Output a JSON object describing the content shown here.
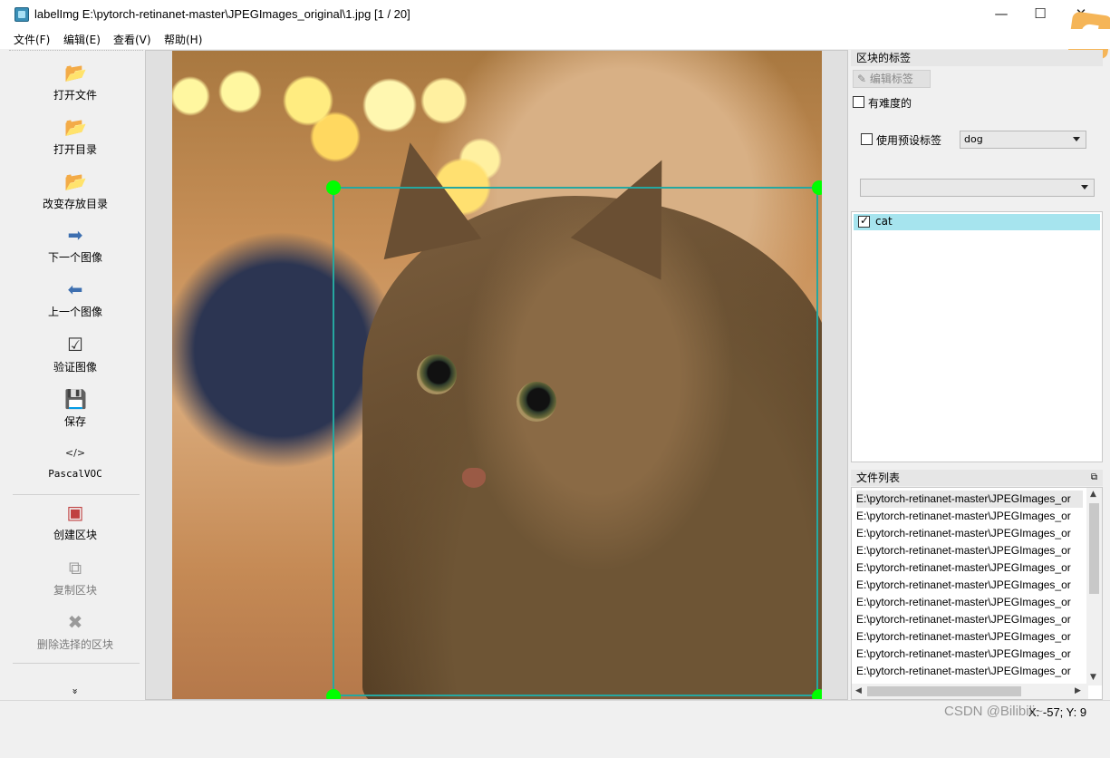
{
  "window": {
    "title": "labelImg E:\\pytorch-retinanet-master\\JPEGImages_original\\1.jpg [1 / 20]",
    "minimize": "—",
    "maximize": "☐",
    "close": "✕"
  },
  "menubar": {
    "file": "文件(F)",
    "edit": "编辑(E)",
    "view": "查看(V)",
    "help": "帮助(H)"
  },
  "toolbar": {
    "items": [
      {
        "label": "打开文件",
        "icon": "folder-open-icon",
        "glyph": "📂",
        "enabled": true
      },
      {
        "label": "打开目录",
        "icon": "folder-open-icon",
        "glyph": "📂",
        "enabled": true
      },
      {
        "label": "改变存放目录",
        "icon": "folder-open-icon",
        "glyph": "📂",
        "enabled": true
      },
      {
        "label": "下一个图像",
        "icon": "arrow-right-icon",
        "glyph": "➡",
        "enabled": true
      },
      {
        "label": "上一个图像",
        "icon": "arrow-left-icon",
        "glyph": "⬅",
        "enabled": true
      },
      {
        "label": "验证图像",
        "icon": "checkbox-icon",
        "glyph": "☑",
        "enabled": true
      },
      {
        "label": "保存",
        "icon": "save-icon",
        "glyph": "💾",
        "enabled": true
      },
      {
        "label": "PascalVOC",
        "icon": "code-icon",
        "glyph": "</>",
        "enabled": true
      },
      {
        "label": "创建区块",
        "icon": "create-box-icon",
        "glyph": "▣",
        "enabled": true
      },
      {
        "label": "复制区块",
        "icon": "copy-box-icon",
        "glyph": "⧉",
        "enabled": false
      },
      {
        "label": "删除选择的区块",
        "icon": "delete-icon",
        "glyph": "✖",
        "enabled": false
      }
    ],
    "more": "»"
  },
  "label_dock": {
    "title": "区块的标签",
    "edit_label_button": "编辑标签",
    "difficult": "有难度的",
    "use_default_label": "使用预设标签",
    "default_label_value": "dog",
    "label_combo_value": "",
    "labels": [
      {
        "text": "cat",
        "checked": true
      }
    ]
  },
  "file_dock": {
    "title": "文件列表",
    "files": [
      "E:\\pytorch-retinanet-master\\JPEGImages_or",
      "E:\\pytorch-retinanet-master\\JPEGImages_or",
      "E:\\pytorch-retinanet-master\\JPEGImages_or",
      "E:\\pytorch-retinanet-master\\JPEGImages_or",
      "E:\\pytorch-retinanet-master\\JPEGImages_or",
      "E:\\pytorch-retinanet-master\\JPEGImages_or",
      "E:\\pytorch-retinanet-master\\JPEGImages_or",
      "E:\\pytorch-retinanet-master\\JPEGImages_or",
      "E:\\pytorch-retinanet-master\\JPEGImages_or",
      "E:\\pytorch-retinanet-master\\JPEGImages_or",
      "E:\\pytorch-retinanet-master\\JPEGImages_or"
    ]
  },
  "status": {
    "coords": "X: -57; Y: 9",
    "watermark": "CSDN @Bilibili~"
  },
  "colors": {
    "bbox_edge": "#26a7a0",
    "bbox_handle": "#00ff00",
    "selected_label_bg": "#a6e4ee"
  }
}
